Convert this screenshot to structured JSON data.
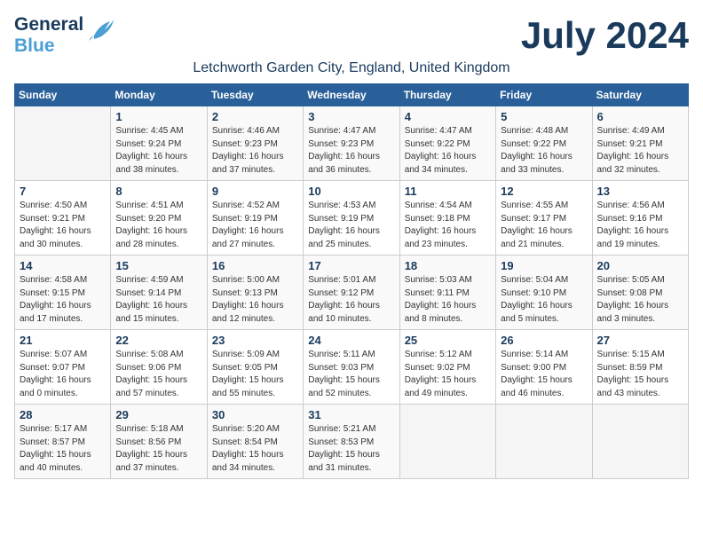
{
  "header": {
    "logo_line1": "General",
    "logo_line2": "Blue",
    "month": "July 2024",
    "location": "Letchworth Garden City, England, United Kingdom"
  },
  "weekdays": [
    "Sunday",
    "Monday",
    "Tuesday",
    "Wednesday",
    "Thursday",
    "Friday",
    "Saturday"
  ],
  "weeks": [
    [
      {
        "day": "",
        "sunrise": "",
        "sunset": "",
        "daylight": ""
      },
      {
        "day": "1",
        "sunrise": "Sunrise: 4:45 AM",
        "sunset": "Sunset: 9:24 PM",
        "daylight": "Daylight: 16 hours and 38 minutes."
      },
      {
        "day": "2",
        "sunrise": "Sunrise: 4:46 AM",
        "sunset": "Sunset: 9:23 PM",
        "daylight": "Daylight: 16 hours and 37 minutes."
      },
      {
        "day": "3",
        "sunrise": "Sunrise: 4:47 AM",
        "sunset": "Sunset: 9:23 PM",
        "daylight": "Daylight: 16 hours and 36 minutes."
      },
      {
        "day": "4",
        "sunrise": "Sunrise: 4:47 AM",
        "sunset": "Sunset: 9:22 PM",
        "daylight": "Daylight: 16 hours and 34 minutes."
      },
      {
        "day": "5",
        "sunrise": "Sunrise: 4:48 AM",
        "sunset": "Sunset: 9:22 PM",
        "daylight": "Daylight: 16 hours and 33 minutes."
      },
      {
        "day": "6",
        "sunrise": "Sunrise: 4:49 AM",
        "sunset": "Sunset: 9:21 PM",
        "daylight": "Daylight: 16 hours and 32 minutes."
      }
    ],
    [
      {
        "day": "7",
        "sunrise": "Sunrise: 4:50 AM",
        "sunset": "Sunset: 9:21 PM",
        "daylight": "Daylight: 16 hours and 30 minutes."
      },
      {
        "day": "8",
        "sunrise": "Sunrise: 4:51 AM",
        "sunset": "Sunset: 9:20 PM",
        "daylight": "Daylight: 16 hours and 28 minutes."
      },
      {
        "day": "9",
        "sunrise": "Sunrise: 4:52 AM",
        "sunset": "Sunset: 9:19 PM",
        "daylight": "Daylight: 16 hours and 27 minutes."
      },
      {
        "day": "10",
        "sunrise": "Sunrise: 4:53 AM",
        "sunset": "Sunset: 9:19 PM",
        "daylight": "Daylight: 16 hours and 25 minutes."
      },
      {
        "day": "11",
        "sunrise": "Sunrise: 4:54 AM",
        "sunset": "Sunset: 9:18 PM",
        "daylight": "Daylight: 16 hours and 23 minutes."
      },
      {
        "day": "12",
        "sunrise": "Sunrise: 4:55 AM",
        "sunset": "Sunset: 9:17 PM",
        "daylight": "Daylight: 16 hours and 21 minutes."
      },
      {
        "day": "13",
        "sunrise": "Sunrise: 4:56 AM",
        "sunset": "Sunset: 9:16 PM",
        "daylight": "Daylight: 16 hours and 19 minutes."
      }
    ],
    [
      {
        "day": "14",
        "sunrise": "Sunrise: 4:58 AM",
        "sunset": "Sunset: 9:15 PM",
        "daylight": "Daylight: 16 hours and 17 minutes."
      },
      {
        "day": "15",
        "sunrise": "Sunrise: 4:59 AM",
        "sunset": "Sunset: 9:14 PM",
        "daylight": "Daylight: 16 hours and 15 minutes."
      },
      {
        "day": "16",
        "sunrise": "Sunrise: 5:00 AM",
        "sunset": "Sunset: 9:13 PM",
        "daylight": "Daylight: 16 hours and 12 minutes."
      },
      {
        "day": "17",
        "sunrise": "Sunrise: 5:01 AM",
        "sunset": "Sunset: 9:12 PM",
        "daylight": "Daylight: 16 hours and 10 minutes."
      },
      {
        "day": "18",
        "sunrise": "Sunrise: 5:03 AM",
        "sunset": "Sunset: 9:11 PM",
        "daylight": "Daylight: 16 hours and 8 minutes."
      },
      {
        "day": "19",
        "sunrise": "Sunrise: 5:04 AM",
        "sunset": "Sunset: 9:10 PM",
        "daylight": "Daylight: 16 hours and 5 minutes."
      },
      {
        "day": "20",
        "sunrise": "Sunrise: 5:05 AM",
        "sunset": "Sunset: 9:08 PM",
        "daylight": "Daylight: 16 hours and 3 minutes."
      }
    ],
    [
      {
        "day": "21",
        "sunrise": "Sunrise: 5:07 AM",
        "sunset": "Sunset: 9:07 PM",
        "daylight": "Daylight: 16 hours and 0 minutes."
      },
      {
        "day": "22",
        "sunrise": "Sunrise: 5:08 AM",
        "sunset": "Sunset: 9:06 PM",
        "daylight": "Daylight: 15 hours and 57 minutes."
      },
      {
        "day": "23",
        "sunrise": "Sunrise: 5:09 AM",
        "sunset": "Sunset: 9:05 PM",
        "daylight": "Daylight: 15 hours and 55 minutes."
      },
      {
        "day": "24",
        "sunrise": "Sunrise: 5:11 AM",
        "sunset": "Sunset: 9:03 PM",
        "daylight": "Daylight: 15 hours and 52 minutes."
      },
      {
        "day": "25",
        "sunrise": "Sunrise: 5:12 AM",
        "sunset": "Sunset: 9:02 PM",
        "daylight": "Daylight: 15 hours and 49 minutes."
      },
      {
        "day": "26",
        "sunrise": "Sunrise: 5:14 AM",
        "sunset": "Sunset: 9:00 PM",
        "daylight": "Daylight: 15 hours and 46 minutes."
      },
      {
        "day": "27",
        "sunrise": "Sunrise: 5:15 AM",
        "sunset": "Sunset: 8:59 PM",
        "daylight": "Daylight: 15 hours and 43 minutes."
      }
    ],
    [
      {
        "day": "28",
        "sunrise": "Sunrise: 5:17 AM",
        "sunset": "Sunset: 8:57 PM",
        "daylight": "Daylight: 15 hours and 40 minutes."
      },
      {
        "day": "29",
        "sunrise": "Sunrise: 5:18 AM",
        "sunset": "Sunset: 8:56 PM",
        "daylight": "Daylight: 15 hours and 37 minutes."
      },
      {
        "day": "30",
        "sunrise": "Sunrise: 5:20 AM",
        "sunset": "Sunset: 8:54 PM",
        "daylight": "Daylight: 15 hours and 34 minutes."
      },
      {
        "day": "31",
        "sunrise": "Sunrise: 5:21 AM",
        "sunset": "Sunset: 8:53 PM",
        "daylight": "Daylight: 15 hours and 31 minutes."
      },
      {
        "day": "",
        "sunrise": "",
        "sunset": "",
        "daylight": ""
      },
      {
        "day": "",
        "sunrise": "",
        "sunset": "",
        "daylight": ""
      },
      {
        "day": "",
        "sunrise": "",
        "sunset": "",
        "daylight": ""
      }
    ]
  ]
}
